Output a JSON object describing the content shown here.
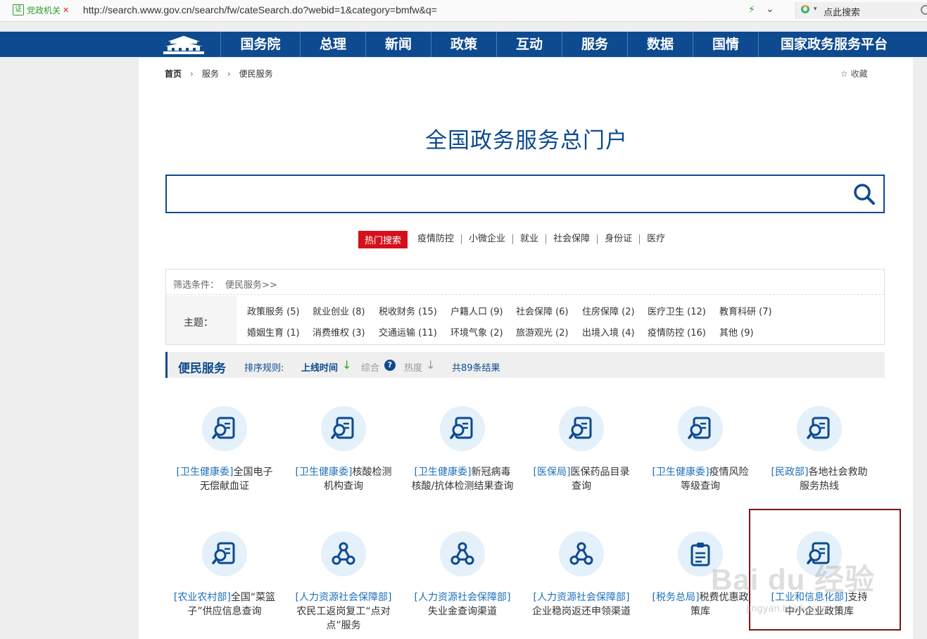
{
  "browser": {
    "site_badge": "党政机关",
    "cert_glyph": "证",
    "url": "http://search.www.gov.cn/search/fw/cateSearch.do?webid=1&category=bmfw&q=",
    "search_placeholder": "点此搜索"
  },
  "nav": {
    "items": [
      "国务院",
      "总理",
      "新闻",
      "政策",
      "互动",
      "服务",
      "数据",
      "国情",
      "国家政务服务平台"
    ]
  },
  "breadcrumb": {
    "home": "首页",
    "sep": "›",
    "level1": "服务",
    "level2": "便民服务"
  },
  "favorite": "☆ 收藏",
  "portal_title": "全国政务服务总门户",
  "search": {
    "value": ""
  },
  "hot": {
    "label": "热门搜索",
    "keywords": [
      "疫情防控",
      "小微企业",
      "就业",
      "社会保障",
      "身份证",
      "医疗"
    ]
  },
  "filter": {
    "label": "筛选条件：",
    "value": "便民服务>>",
    "topic_label": "主题：",
    "topics_row1": [
      "政策服务 (5)",
      "就业创业 (8)",
      "税收财务 (15)",
      "户籍人口 (9)",
      "社会保障 (6)",
      "住房保障 (2)",
      "医疗卫生 (12)",
      "教育科研 (7)"
    ],
    "topics_row2": [
      "婚姻生育 (1)",
      "消费维权 (3)",
      "交通运输 (11)",
      "环境气象 (2)",
      "旅游观光 (2)",
      "出境入境 (4)",
      "疫情防控 (16)",
      "其他 (9)"
    ]
  },
  "sort": {
    "section": "便民服务",
    "label": "排序规则:",
    "by_time": "上线时间",
    "comprehensive": "综合",
    "help": "?",
    "heat": "热度",
    "total": "共89条结果",
    "arrow": "↓"
  },
  "services": [
    {
      "org": "[卫生健康委]",
      "name": "全国电子无偿献血证",
      "icon": "search-doc-icon"
    },
    {
      "org": "[卫生健康委]",
      "name": "核酸检测机构查询",
      "icon": "search-doc-icon"
    },
    {
      "org": "[卫生健康委]",
      "name": "新冠病毒核酸/抗体检测结果查询",
      "icon": "search-doc-icon"
    },
    {
      "org": "[医保局]",
      "name": "医保药品目录查询",
      "icon": "search-doc-icon"
    },
    {
      "org": "[卫生健康委]",
      "name": "疫情风险等级查询",
      "icon": "search-doc-icon"
    },
    {
      "org": "[民政部]",
      "name": "各地社会救助服务热线",
      "icon": "search-doc-icon"
    },
    {
      "org": "[农业农村部]",
      "name": "全国“菜篮子”供应信息查询",
      "icon": "search-doc-icon"
    },
    {
      "org": "[人力资源社会保障部]",
      "name": "农民工返岗复工“点对点”服务",
      "icon": "network-icon"
    },
    {
      "org": "[人力资源社会保障部]",
      "name": "失业金查询渠道",
      "icon": "network-icon"
    },
    {
      "org": "[人力资源社会保障部]",
      "name": "企业稳岗返还申领渠道",
      "icon": "network-icon"
    },
    {
      "org": "[税务总局]",
      "name": "税费优惠政策库",
      "icon": "clipboard-icon"
    },
    {
      "org": "[工业和信息化部]",
      "name": "支持中小企业政策库",
      "icon": "search-doc-icon"
    }
  ],
  "watermark": {
    "main": "Bai du 经验",
    "sub": "jingyan.baidu.com"
  },
  "colors": {
    "brand": "#0d4a8f",
    "hot": "#d4111b",
    "link": "#1d6fb8",
    "highlight": "#7b1416"
  }
}
